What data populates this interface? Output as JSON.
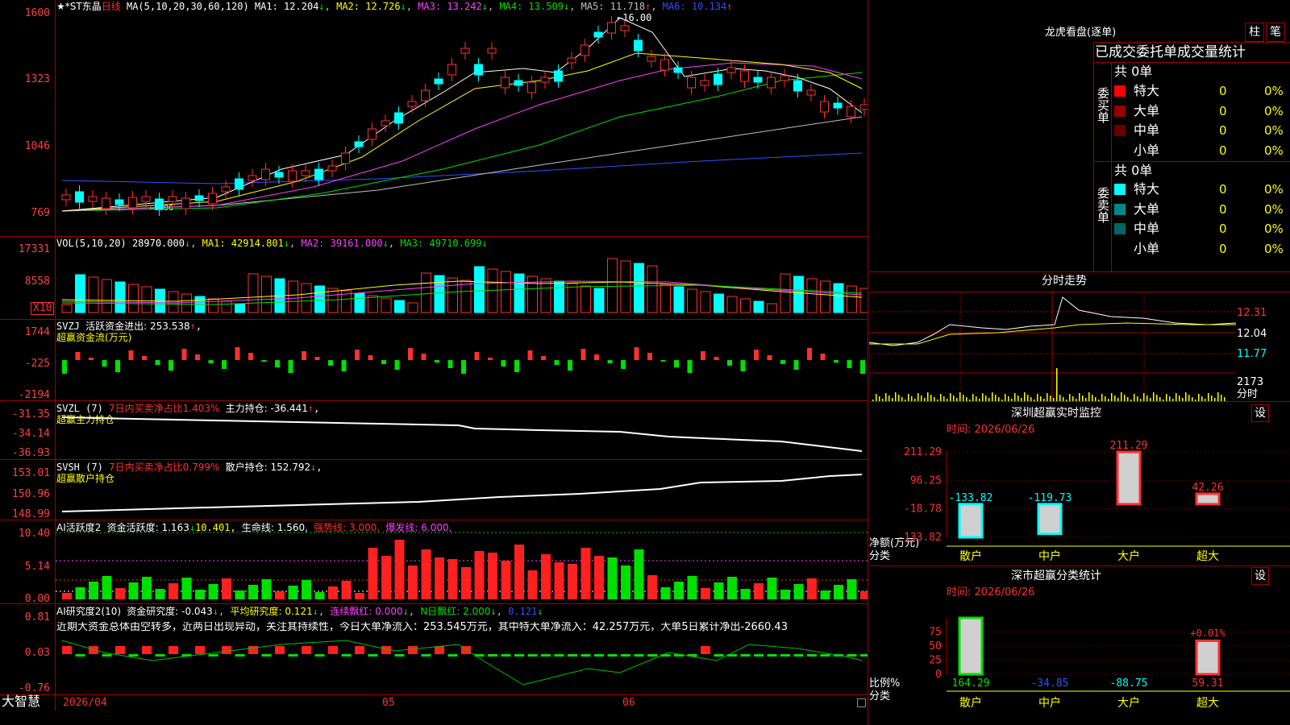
{
  "stock": {
    "name": "★*ST东晶",
    "period": "日线"
  },
  "panels": {
    "main": {
      "ma_label": "MA(5,10,20,30,60,120)",
      "ma": [
        {
          "label": "MA1: 12.204",
          "arrow": "↓",
          "color": "#ffffff"
        },
        {
          "label": "MA2: 12.726",
          "arrow": "↓",
          "color": "#ffff00"
        },
        {
          "label": "MA3: 13.242",
          "arrow": "↓",
          "color": "#ff40ff"
        },
        {
          "label": "MA4: 13.509",
          "arrow": "↓",
          "color": "#00e000"
        },
        {
          "label": "MA5: 11.718",
          "arrow": "↑",
          "color": "#c0c0c0"
        },
        {
          "label": "MA6: 10.134",
          "arrow": "↑",
          "color": "#3050ff"
        }
      ],
      "y_ticks": [
        "1600",
        "1323",
        "1046",
        "769"
      ],
      "high_mark": "16.00",
      "low_mark": "8.06"
    },
    "vol": {
      "label": "VOL(5,10,20)",
      "value": "28970.000",
      "arrow": "↓",
      "ma1": "MA1: 42914.801",
      "ma1_arrow": "↓",
      "ma2": "MA2: 39161.000",
      "ma2_arrow": "↓",
      "ma3": "MA3: 49710.699",
      "ma3_arrow": "↓",
      "y_ticks": [
        "17331",
        "8558"
      ],
      "unit": "X10"
    },
    "svzj": {
      "label": "SVZJ",
      "desc": "活跃资金进出: 253.538",
      "arrow": "↑",
      "comma": ",",
      "subtitle": "超赢资金流(万元)",
      "y_ticks": [
        "1744",
        "-225",
        "-2194"
      ]
    },
    "svzl": {
      "label": "SVZL (7)",
      "pct": "7日内买卖净占比1.403%",
      "val": "主力持仓: -36.441",
      "arrow": "↑",
      "comma": ",",
      "subtitle": "超赢主力持仓",
      "y_ticks": [
        "-31.35",
        "-34.14",
        "-36.93"
      ]
    },
    "svsh": {
      "label": "SVSH (7)",
      "pct": "7日内买卖净占比0.799%",
      "val": "散户持仓: 152.792",
      "arrow": "↓",
      "comma": ",",
      "subtitle": "超赢散户持仓",
      "y_ticks": [
        "153.01",
        "150.96",
        "148.99"
      ]
    },
    "ai2": {
      "label": "AI活跃度2",
      "v1": "资金活跃度: 1.163",
      "a1": "↓",
      "v2": "10.401,",
      "v3": "生命线: 1.560,",
      "v4": "强势线: 3.000,",
      "v5": "爆发线: 6.000,",
      "y_ticks": [
        "10.40",
        "5.14",
        "0.00"
      ]
    },
    "ai_res": {
      "label": "AI研究度2(10)",
      "v1": "资金研究度: -0.043",
      "a1": "↓",
      "v2": "平均研究度: 0.121",
      "a2": "↓",
      "v3": "连续飘红: 0.000",
      "a3": "↓",
      "v4": "N日飘红: 2.000",
      "a4": "↓",
      "v5": "0.121",
      "a5": "↓",
      "note": "近期大资金总体由空转多，近两日出现异动，关注其持续性，今日大单净流入：253.545万元，其中特大单净流入：42.257万元，大单5日累计净出-2660.43",
      "y_ticks": [
        "0.81",
        "0.03",
        "-0.76"
      ]
    }
  },
  "x_axis": {
    "labels": [
      "2026/04",
      "05",
      "06"
    ],
    "brand": "大智慧"
  },
  "right": {
    "dragon_title": "龙虎看盘(逐单)",
    "btn_col": "柱",
    "btn_pen": "笔",
    "stats_title": "已成交委托单成交量统计",
    "buy": {
      "side": "委买单",
      "total": "共 0单",
      "rows": [
        {
          "name": "特大",
          "vol": "0",
          "pct": "0%",
          "color": "#ff0000"
        },
        {
          "name": "大单",
          "vol": "0",
          "pct": "0%",
          "color": "#990000"
        },
        {
          "name": "中单",
          "vol": "0",
          "pct": "0%",
          "color": "#660000"
        },
        {
          "name": "小单",
          "vol": "0",
          "pct": "0%",
          "color": ""
        }
      ]
    },
    "sell": {
      "side": "委卖单",
      "total": "共 0单",
      "rows": [
        {
          "name": "特大",
          "vol": "0",
          "pct": "0%",
          "color": "#00ffff"
        },
        {
          "name": "大单",
          "vol": "0",
          "pct": "0%",
          "color": "#008888"
        },
        {
          "name": "中单",
          "vol": "0",
          "pct": "0%",
          "color": "#006666"
        },
        {
          "name": "小单",
          "vol": "0",
          "pct": "0%",
          "color": ""
        }
      ]
    },
    "intraday": {
      "title": "分时走势",
      "y_ticks": [
        "12.31",
        "12.04",
        "11.77"
      ],
      "vol_tick": "2173",
      "vol_label": "分时"
    },
    "sz_monitor": {
      "title": "深圳超赢实时监控",
      "set": "设",
      "time": "时间: 2026/06/26",
      "y_ticks": [
        "211.29",
        "96.25",
        "-18.78",
        "-133.82"
      ],
      "ylabel": "净额(万元)",
      "xlabel": "分类",
      "bars": [
        {
          "cat": "散户",
          "value": -133.82,
          "label": "-133.82"
        },
        {
          "cat": "中户",
          "value": -119.73,
          "label": "-119.73"
        },
        {
          "cat": "大户",
          "value": 211.29,
          "label": "211.29"
        },
        {
          "cat": "超大",
          "value": 42.26,
          "label": "42.26"
        }
      ]
    },
    "sz_class": {
      "title": "深市超赢分类统计",
      "set": "设",
      "time": "时间: 2026/06/26",
      "y_ticks": [
        "75",
        "50",
        "25",
        "0"
      ],
      "ylabel": "比例%",
      "xlabel": "分类",
      "extra_label": "+0.01%",
      "bars": [
        {
          "cat": "散户",
          "value": 164.29,
          "label": "164.29"
        },
        {
          "cat": "中户",
          "value": -34.85,
          "label": "-34.85"
        },
        {
          "cat": "大户",
          "value": -88.75,
          "label": "-88.75"
        },
        {
          "cat": "超大",
          "value": 59.31,
          "label": "59.31"
        }
      ]
    }
  }
}
